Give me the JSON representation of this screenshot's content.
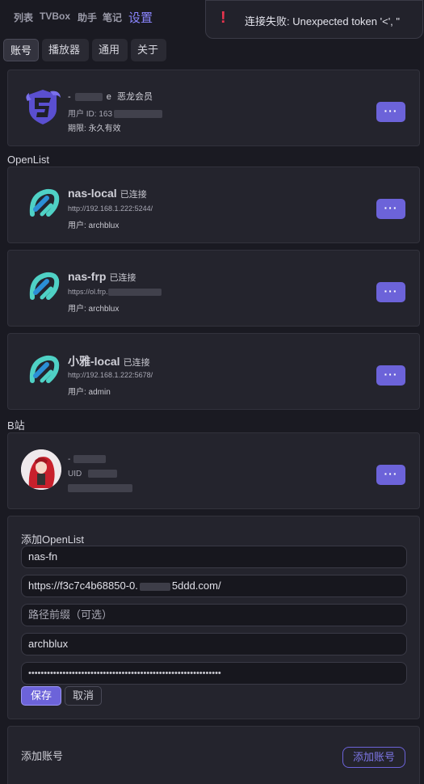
{
  "nav": {
    "items": [
      "列表",
      "TVBox",
      "助手",
      "笔记"
    ],
    "active": "设置"
  },
  "toast": {
    "icon": "!",
    "message": "连接失败: Unexpected token '<', \""
  },
  "tabs": [
    "账号",
    "播放器",
    "通用",
    "关于"
  ],
  "account": {
    "name_prefix": "-",
    "name_suffix": "e",
    "badge": "恶龙会员",
    "user_id_label": "用户 ID: 163",
    "expiry": "期限: 永久有效",
    "more": "···"
  },
  "openlist": {
    "section_label": "OpenList",
    "items": [
      {
        "name": "nas-local",
        "status": "已连接",
        "url": "http://192.168.1.222:5244/",
        "user": "用户: archblux",
        "more": "···"
      },
      {
        "name": "nas-frp",
        "status": "已连接",
        "url": "https://ol.frp.",
        "user": "用户: archblux",
        "more": "···"
      },
      {
        "name": "小雅-local",
        "status": "已连接",
        "url": "http://192.168.1.222:5678/",
        "user": "用户: admin",
        "more": "···"
      }
    ]
  },
  "bilibili": {
    "section_label": "B站",
    "name": "-",
    "uid_label": "UID",
    "more": "···"
  },
  "add_openlist": {
    "title": "添加OpenList",
    "name_value": "nas-fn",
    "url_value_start": "https://f3c7c4b68850-0.",
    "url_value_end": "5ddd.com/",
    "prefix_placeholder": "路径前缀（可选）",
    "username_value": "archblux",
    "password_mask": "••••••••••••••••••••••••••••••••••••••••••••••••••••••••••••••",
    "save": "保存",
    "cancel": "取消"
  },
  "add_account": {
    "label": "添加账号",
    "button": "添加账号"
  },
  "colors": {
    "accent": "#6c63d9",
    "error": "#e8344e",
    "background": "#1a1a22",
    "card": "#24242d",
    "openlist_logo": "#4fd1c5"
  }
}
